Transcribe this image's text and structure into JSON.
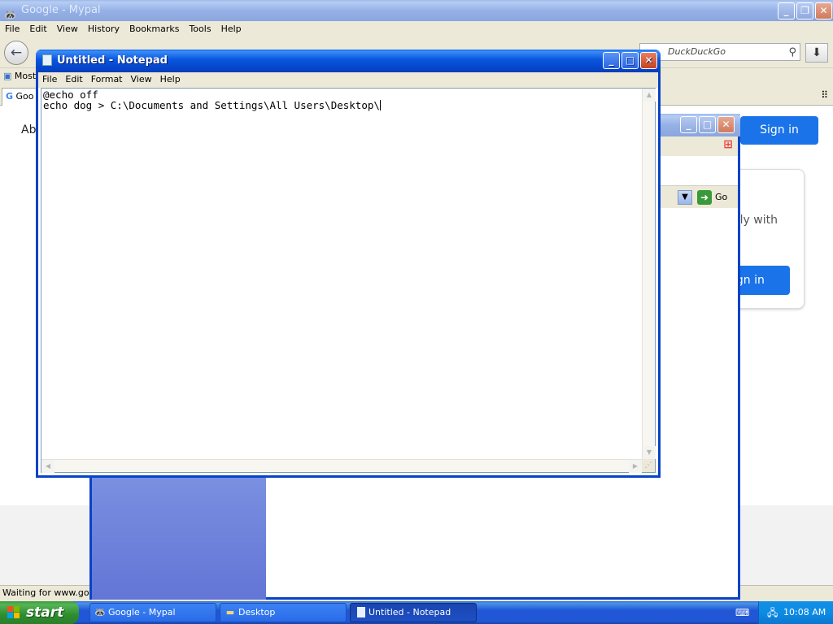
{
  "browser": {
    "title": "Google - Mypal",
    "menu": [
      "File",
      "Edit",
      "View",
      "History",
      "Bookmarks",
      "Tools",
      "Help"
    ],
    "search_placeholder": "DuckDuckGo",
    "bookmarks_label": "Most",
    "tab_label": "Goo",
    "page_partial_text": "Ab",
    "signin_label": "Sign in",
    "card_text": "ely with",
    "card_button": "ign in",
    "status": "Waiting for www.goog"
  },
  "explorer": {
    "go_label": "Go"
  },
  "notepad": {
    "title": "Untitled - Notepad",
    "menu": [
      "File",
      "Edit",
      "Format",
      "View",
      "Help"
    ],
    "lines": [
      "@echo off",
      "echo dog > C:\\Documents and Settings\\All Users\\Desktop\\"
    ]
  },
  "taskbar": {
    "start_label": "start",
    "buttons": [
      {
        "label": "Google - Mypal",
        "icon": "mypal-icon",
        "active": false
      },
      {
        "label": "Desktop",
        "icon": "folder-icon",
        "active": false
      },
      {
        "label": "Untitled - Notepad",
        "icon": "notepad-icon",
        "active": true
      }
    ],
    "clock": "10:08 AM"
  }
}
